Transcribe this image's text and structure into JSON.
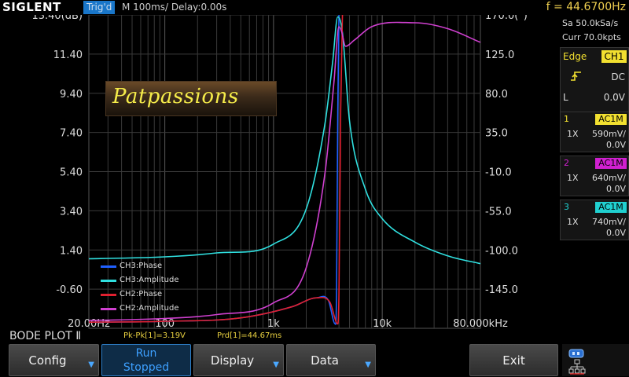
{
  "header": {
    "brand": "SIGLENT",
    "trig_status": "Trig'd",
    "timebase": "M 100ms/  Delay:0.00s",
    "frequency": "f = 44.6700Hz"
  },
  "right_panel": {
    "sample_rate": "Sa 50.0kSa/s",
    "memory": "Curr 70.0kpts",
    "trigger": {
      "mode_label": "Edge",
      "source": "CH1",
      "slope_icon": "rising-edge-icon",
      "coupling": "DC",
      "level_label": "L",
      "level": "0.0V"
    },
    "channels": [
      {
        "num": "1",
        "coupling": "AC1M",
        "probe": "1X",
        "scale": "590mV/",
        "offset": "0.0V",
        "color": "#f2e030"
      },
      {
        "num": "2",
        "coupling": "AC1M",
        "probe": "1X",
        "scale": "640mV/",
        "offset": "0.0V",
        "color": "#d020d0"
      },
      {
        "num": "3",
        "coupling": "AC1M",
        "probe": "1X",
        "scale": "740mV/",
        "offset": "0.0V",
        "color": "#20d0d0"
      }
    ]
  },
  "watermark": "Patpassions",
  "status": {
    "mode": "BODE PLOT Ⅱ",
    "pkpk": "Pk-Pk[1]=3.19V",
    "prd": "Prd[1]=44.67ms"
  },
  "menu": {
    "config": "Config",
    "run_line1": "Run",
    "run_line2": "Stopped",
    "display": "Display",
    "data": "Data",
    "exit": "Exit"
  },
  "chart_data": {
    "type": "line",
    "title": "",
    "xscale": "log",
    "xlim": [
      20,
      80000
    ],
    "x_tick_labels": [
      "20.00Hz",
      "100",
      "1k",
      "10k",
      "80.000kHz"
    ],
    "x_tick_values": [
      20,
      100,
      1000,
      10000,
      80000
    ],
    "ylim": [
      -2.6,
      13.4
    ],
    "y_tick_labels": [
      "13.40(dB)",
      "11.40",
      "9.40",
      "7.40",
      "5.40",
      "3.40",
      "1.40",
      "-0.60"
    ],
    "y_tick_values": [
      13.4,
      11.4,
      9.4,
      7.4,
      5.4,
      3.4,
      1.4,
      -0.6
    ],
    "y2lim": [
      -190,
      170
    ],
    "y2_tick_labels": [
      "170.0(°)",
      "125.0",
      "80.0",
      "35.0",
      "-10.0",
      "-55.0",
      "-100.0",
      "-145.0"
    ],
    "y2_tick_values": [
      170,
      125,
      80,
      35,
      -10,
      -55,
      -100,
      -145
    ],
    "grid": true,
    "legend_position": "bottom-left",
    "series": [
      {
        "name": "CH3:Phase",
        "color": "#2060ff",
        "axis": "right",
        "x": [
          20,
          100,
          500,
          1500,
          2500,
          3200,
          3700,
          3800,
          3900,
          4000,
          10000,
          80000
        ],
        "values": [
          -183,
          -182,
          -178,
          -165,
          -155,
          -158,
          -185,
          -150,
          60,
          170,
          178,
          179
        ]
      },
      {
        "name": "CH3:Amplitude",
        "color": "#30e0e0",
        "axis": "left",
        "x": [
          20,
          100,
          300,
          1000,
          2000,
          3000,
          3500,
          3900,
          4300,
          5000,
          7000,
          10000,
          20000,
          40000,
          80000
        ],
        "values": [
          0.95,
          1.05,
          1.25,
          1.7,
          3.5,
          8.0,
          11.0,
          13.3,
          12.5,
          8.0,
          4.5,
          3.0,
          1.8,
          1.1,
          0.7
        ]
      },
      {
        "name": "CH2:Phase",
        "color": "#e02030",
        "axis": "right",
        "x": [
          20,
          100,
          500,
          1500,
          2500,
          3300,
          3900,
          4000,
          4150,
          4300,
          10000,
          80000
        ],
        "values": [
          -183,
          -182,
          -178,
          -165,
          -155,
          -160,
          -185,
          -150,
          60,
          168,
          176,
          178
        ]
      },
      {
        "name": "CH2:Amplitude",
        "color": "#d040d0",
        "axis": "left",
        "x": [
          20,
          100,
          300,
          1000,
          2000,
          3000,
          3600,
          4000,
          4200,
          4600,
          5500,
          8000,
          20000,
          40000,
          80000
        ],
        "values": [
          -2.2,
          -2.1,
          -1.9,
          -1.3,
          0.5,
          5.5,
          10.0,
          12.8,
          12.6,
          11.8,
          12.1,
          12.8,
          13.0,
          12.7,
          12.0
        ]
      }
    ]
  }
}
